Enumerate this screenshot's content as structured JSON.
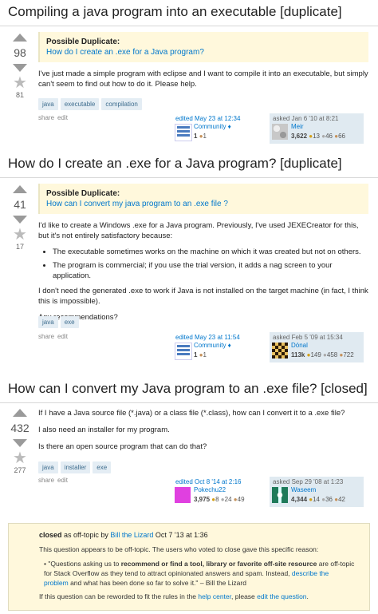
{
  "questions": [
    {
      "title": "Compiling a java program into an executable [duplicate]",
      "score": "98",
      "favorites": "81",
      "dup_label": "Possible Duplicate:",
      "dup_link": "How do I create an .exe for a Java program?",
      "body": "I've just made a simple program with eclipse and I want to compile it into an executable, but simply can't seem to find out how to do it. Please help.",
      "tags": [
        "java",
        "executable",
        "compilation"
      ],
      "share": "share",
      "edit": "edit",
      "edited": "edited May 23 at 12:34",
      "editor": "Community ♦",
      "editor_rep": "1",
      "editor_bronze": "1",
      "asked": "asked Jan 6 '10 at 8:21",
      "asker": "Meir",
      "asker_rep": "3,622",
      "asker_gold": "13",
      "asker_silver": "46",
      "asker_bronze": "66"
    },
    {
      "title": "How do I create an .exe for a Java program? [duplicate]",
      "score": "41",
      "favorites": "17",
      "dup_label": "Possible Duplicate:",
      "dup_link": "How can I convert my java program to an .exe file ?",
      "body1": "I'd like to create a Windows .exe for a Java program. Previously, I've used JEXECreator for this, but it's not entirely satisfactory because:",
      "bullet1": "The executable sometimes works on the machine on which it was created but not on others.",
      "bullet2": "The program is commercial; if you use the trial version, it adds a nag screen to your application.",
      "body2": "I don't need the generated .exe to work if Java is not installed on the target machine (in fact, I think this is impossible).",
      "body3": "Any recommendations?",
      "tags": [
        "java",
        "exe"
      ],
      "share": "share",
      "edit": "edit",
      "edited": "edited May 23 at 11:54",
      "editor": "Community ♦",
      "editor_rep": "1",
      "editor_bronze": "1",
      "asked": "asked Feb 5 '09 at 15:34",
      "asker": "Dónal",
      "asker_rep": "113k",
      "asker_gold": "149",
      "asker_silver": "458",
      "asker_bronze": "722"
    },
    {
      "title": "How can I convert my Java program to an .exe file? [closed]",
      "score": "432",
      "favorites": "277",
      "body1": "If I have a Java source file (*.java) or a class file (*.class), how can I convert it to a .exe file?",
      "body2": "I also need an installer for my program.",
      "body3": "Is there an open source program that can do that?",
      "tags": [
        "java",
        "installer",
        "exe"
      ],
      "share": "share",
      "edit": "edit",
      "edited": "edited Oct 8 '14 at 2:16",
      "editor": "Pokechu22",
      "editor_rep": "3,975",
      "editor_gold": "8",
      "editor_silver": "24",
      "editor_bronze": "49",
      "asked": "asked Sep 29 '08 at 1:23",
      "asker": "Waseem",
      "asker_rep": "4,344",
      "asker_gold": "14",
      "asker_silver": "36",
      "asker_bronze": "42"
    }
  ],
  "closed": {
    "closed_word": "closed",
    "as_text": " as off-topic by ",
    "closer": "Bill the Lizard",
    "date": " Oct 7 '13 at 1:36",
    "reason": "This question appears to be off-topic. The users who voted to close gave this specific reason:",
    "quote_a": "\"Questions asking us to ",
    "quote_bold": "recommend or find a tool, library or favorite off-site resource",
    "quote_b": " are off-topic for Stack Overflow as they tend to attract opinionated answers and spam. Instead, ",
    "quote_link": "describe the problem",
    "quote_c": " and what has been done so far to solve it.\" – Bill the Lizard",
    "reword_a": "If this question can be reworded to fit the rules in the ",
    "help_center": "help center",
    "reword_b": ", please ",
    "edit_question": "edit the question",
    "reword_c": "."
  }
}
